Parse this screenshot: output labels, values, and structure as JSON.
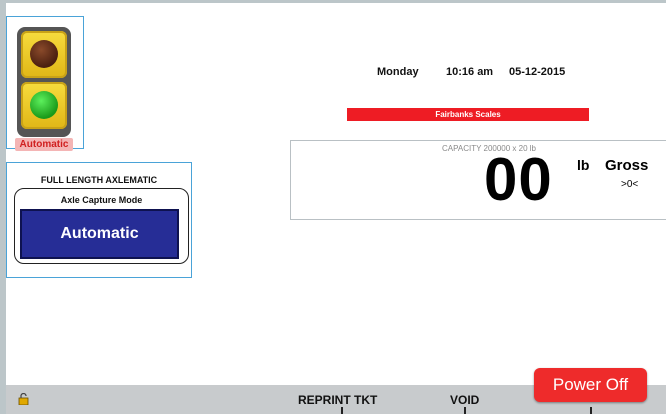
{
  "traffic_light": {
    "label": "Automatic"
  },
  "axlematic": {
    "title": "FULL LENGTH AXLEMATIC",
    "mode_label": "Axle Capture Mode",
    "mode_button": "Automatic"
  },
  "datetime": {
    "day": "Monday",
    "time": "10:16 am",
    "date": "05-12-2015"
  },
  "company": "Fairbanks Scales",
  "scale": {
    "capacity": "CAPACITY 200000 x 20 lb",
    "weight": "00",
    "unit": "lb",
    "mode": "Gross",
    "zero_indicator": ">0<"
  },
  "bottom_bar": {
    "reprint": "REPRINT TKT",
    "void": "VOID",
    "power": "Power Off"
  },
  "colors": {
    "accent_red": "#ee1c24",
    "button_blue": "#262d96",
    "panel_border": "#4aa3d8"
  }
}
